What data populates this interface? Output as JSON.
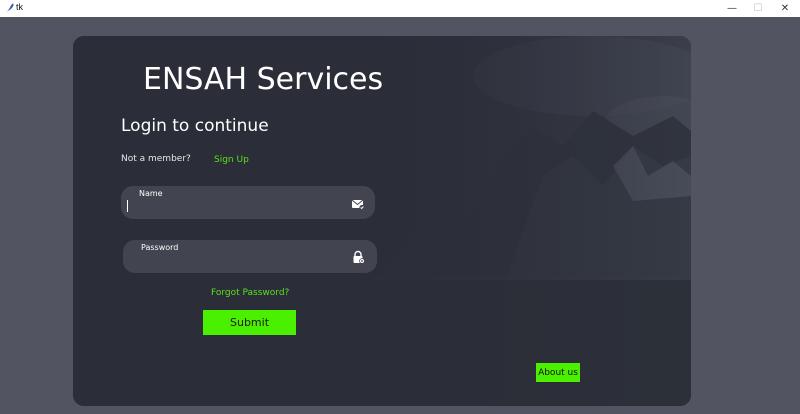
{
  "window": {
    "title": "tk",
    "minimize_glyph": "—",
    "maximize_glyph": "☐",
    "close_glyph": "✕"
  },
  "card": {
    "title": "ENSAH Services",
    "subtitle": "Login to continue",
    "not_member_text": "Not a member?",
    "signup_link": "Sign Up",
    "name_field": {
      "label": "Name",
      "value": "",
      "icon": "mail-check-icon"
    },
    "password_field": {
      "label": "Password",
      "value": "",
      "icon": "lock-icon"
    },
    "forgot_link": "Forgot Password?",
    "submit_label": "Submit",
    "about_label": "About us"
  },
  "colors": {
    "page_bg": "#525461",
    "card_bg": "#2b2d38",
    "field_bg": "#424450",
    "accent_green": "#4bf000",
    "link_green": "#59e01b",
    "text_white": "#ffffff"
  }
}
